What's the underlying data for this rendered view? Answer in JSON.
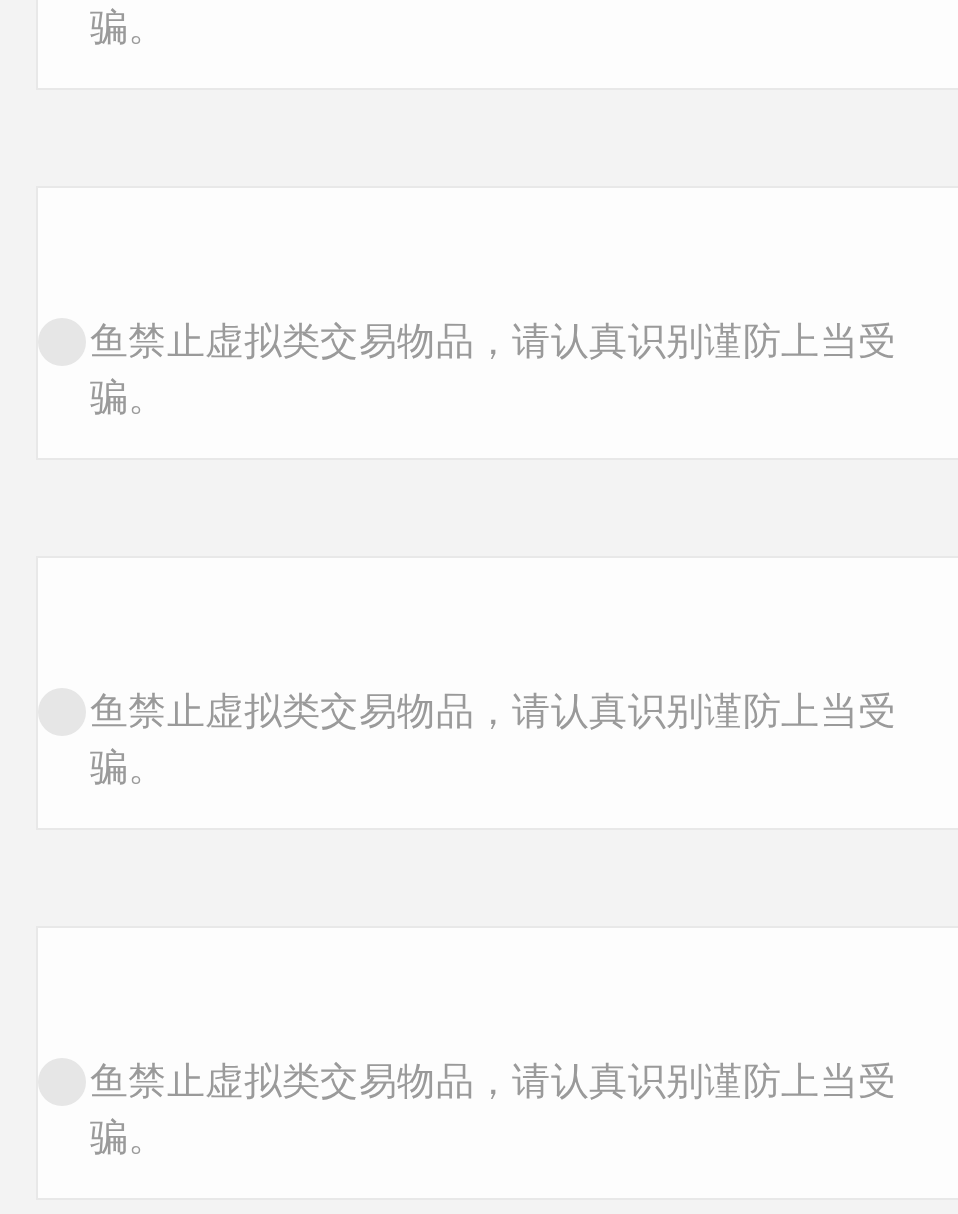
{
  "cards": [
    {
      "kind": "tail",
      "text": "骗。"
    },
    {
      "kind": "post",
      "text": "鱼禁止虚拟类交易物品，请认真识别谨防上当受骗。"
    },
    {
      "kind": "post",
      "text": "鱼禁止虚拟类交易物品，请认真识别谨防上当受骗。"
    },
    {
      "kind": "post",
      "text": "鱼禁止虚拟类交易物品，请认真识别谨防上当受骗。"
    }
  ]
}
